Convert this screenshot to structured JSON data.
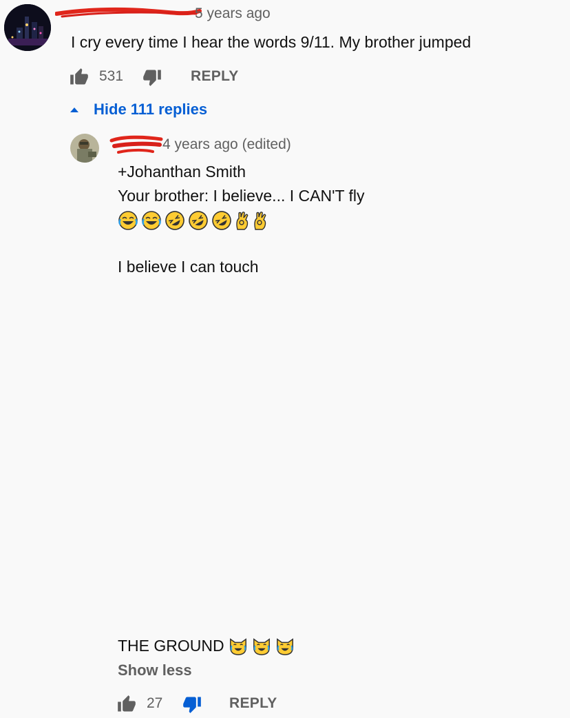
{
  "comment": {
    "timestamp": "5 years ago",
    "text": "I cry every time I hear the words 9/11. My brother jumped",
    "like_count": "531",
    "reply_label": "REPLY",
    "replies_toggle": "Hide 111 replies"
  },
  "reply": {
    "timestamp": "4 years ago (edited)",
    "lines": [
      "+Johanthan Smith",
      "Your brother: I believe... I CAN'T fly"
    ],
    "line_3": "I believe I can touch",
    "line_4": "THE GROUND",
    "show_less": "Show less",
    "like_count": "27",
    "reply_label": "REPLY"
  },
  "icons": {
    "like": "thumb-up-icon",
    "dislike": "thumb-down-icon",
    "collapse": "caret-up-icon",
    "emoji_laugh": "face-with-tears-of-joy-icon",
    "emoji_rofl": "rolling-on-floor-laughing-icon",
    "emoji_ok": "ok-hand-icon",
    "emoji_cat": "cat-with-tears-of-joy-icon"
  },
  "colors": {
    "accent": "#065fd4",
    "redaction": "#e0261b",
    "muted": "#606060"
  }
}
